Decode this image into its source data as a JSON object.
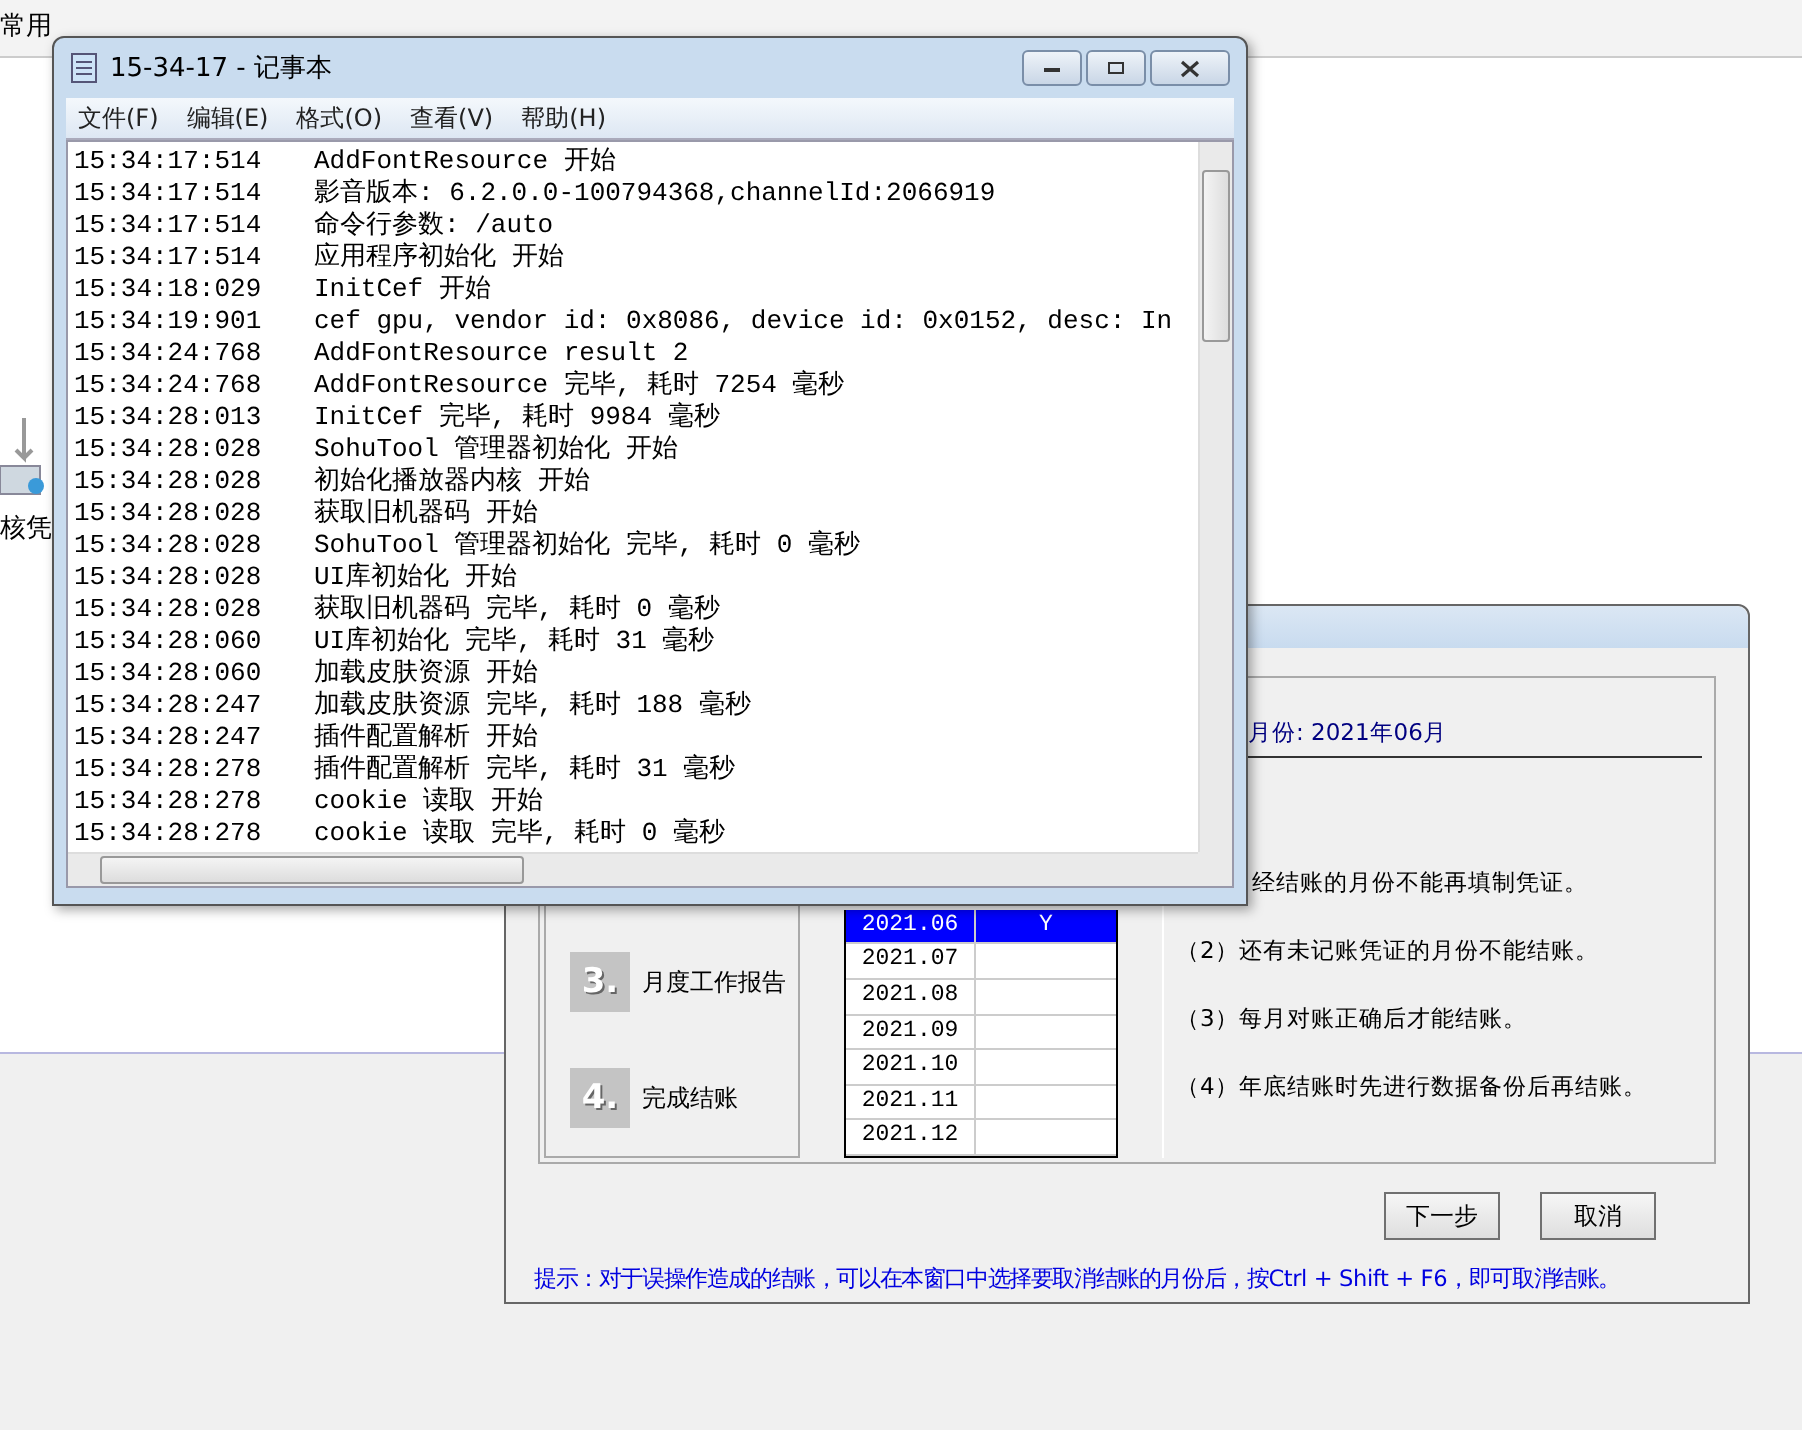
{
  "background_app": {
    "toolbar_label": "常用",
    "side_label": "核凭"
  },
  "notepad": {
    "title": "15-34-17 - 记事本",
    "menu": [
      "文件(F)",
      "编辑(E)",
      "格式(O)",
      "查看(V)",
      "帮助(H)"
    ],
    "lines": [
      {
        "time": "15:34:17:514",
        "message": "AddFontResource 开始"
      },
      {
        "time": "15:34:17:514",
        "message": "影音版本: 6.2.0.0-100794368,channelId:2066919"
      },
      {
        "time": "15:34:17:514",
        "message": "命令行参数: /auto"
      },
      {
        "time": "15:34:17:514",
        "message": "应用程序初始化 开始"
      },
      {
        "time": "15:34:18:029",
        "message": "InitCef 开始"
      },
      {
        "time": "15:34:19:901",
        "message": "cef gpu, vendor id: 0x8086, device id: 0x0152, desc: In"
      },
      {
        "time": "15:34:24:768",
        "message": "AddFontResource result 2"
      },
      {
        "time": "15:34:24:768",
        "message": "AddFontResource 完毕, 耗时 7254 毫秒"
      },
      {
        "time": "15:34:28:013",
        "message": "InitCef 完毕, 耗时 9984 毫秒"
      },
      {
        "time": "15:34:28:028",
        "message": "SohuTool 管理器初始化 开始"
      },
      {
        "time": "15:34:28:028",
        "message": "初始化播放器内核 开始"
      },
      {
        "time": "15:34:28:028",
        "message": "获取旧机器码 开始"
      },
      {
        "time": "15:34:28:028",
        "message": "SohuTool 管理器初始化 完毕, 耗时 0 毫秒"
      },
      {
        "time": "15:34:28:028",
        "message": "UI库初始化 开始"
      },
      {
        "time": "15:34:28:028",
        "message": "获取旧机器码 完毕, 耗时 0 毫秒"
      },
      {
        "time": "15:34:28:060",
        "message": "UI库初始化 完毕, 耗时 31 毫秒"
      },
      {
        "time": "15:34:28:060",
        "message": "加载皮肤资源 开始"
      },
      {
        "time": "15:34:28:247",
        "message": "加载皮肤资源 完毕, 耗时 188 毫秒"
      },
      {
        "time": "15:34:28:247",
        "message": "插件配置解析 开始"
      },
      {
        "time": "15:34:28:278",
        "message": "插件配置解析 完毕, 耗时 31 毫秒"
      },
      {
        "time": "15:34:28:278",
        "message": "cookie 读取 开始"
      },
      {
        "time": "15:34:28:278",
        "message": "cookie 读取 完毕, 耗时 0 毫秒"
      }
    ]
  },
  "closing_dialog": {
    "month_heading": "月份: 2021年06月",
    "steps": [
      {
        "number": "3.",
        "label": "月度工作报告"
      },
      {
        "number": "4.",
        "label": "完成结账"
      }
    ],
    "months": [
      {
        "month": "2021.06",
        "closed": "Y",
        "selected": true
      },
      {
        "month": "2021.07",
        "selected": false
      },
      {
        "month": "2021.08",
        "selected": false
      },
      {
        "month": "2021.09",
        "selected": false
      },
      {
        "month": "2021.10",
        "selected": false
      },
      {
        "month": "2021.11",
        "selected": false
      },
      {
        "month": "2021.12",
        "selected": false
      }
    ],
    "notes": [
      "经结账的月份不能再填制凭证。",
      "（2）还有未记账凭证的月份不能结账。",
      "（3）每月对账正确后才能结账。",
      "（4）年底结账时先进行数据备份后再结账。"
    ],
    "buttons": [
      "下一步",
      "取消"
    ],
    "hint": "提示：对于误操作造成的结账，可以在本窗口中选择要取消结账的月份后，按Ctrl + Shift + F6，即可取消结账。"
  }
}
